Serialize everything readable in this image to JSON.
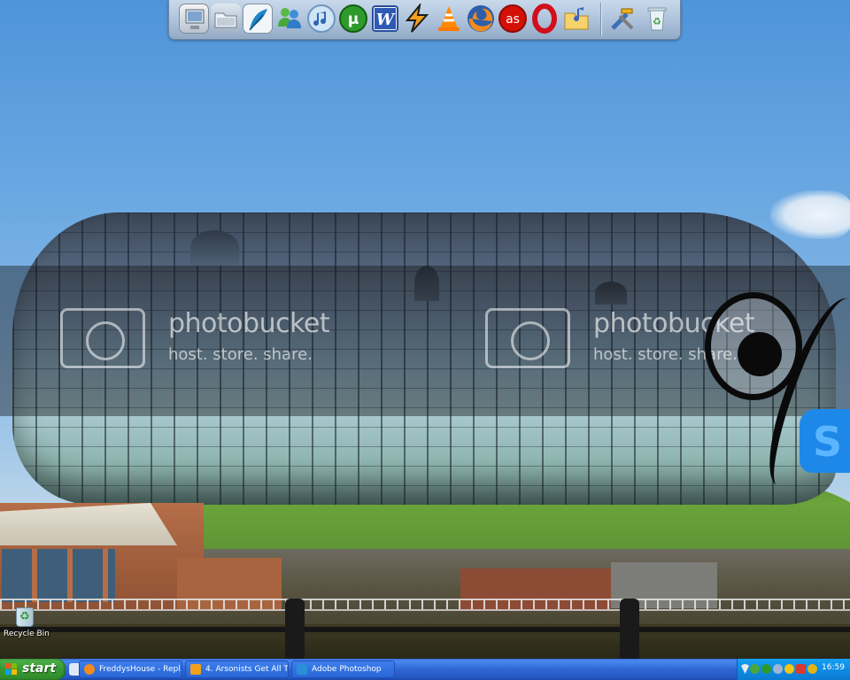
{
  "dock": {
    "items": [
      {
        "name": "my-computer-icon"
      },
      {
        "name": "folder-icon"
      },
      {
        "name": "feather-icon"
      },
      {
        "name": "messenger-icon"
      },
      {
        "name": "itunes-icon"
      },
      {
        "name": "utorrent-icon"
      },
      {
        "name": "word-icon"
      },
      {
        "name": "winamp-icon"
      },
      {
        "name": "vlc-icon"
      },
      {
        "name": "firefox-icon"
      },
      {
        "name": "lastfm-icon"
      },
      {
        "name": "opera-icon"
      },
      {
        "name": "music-folder-icon"
      },
      {
        "name": "tools-icon"
      },
      {
        "name": "recycle-bin-icon"
      }
    ],
    "word_letter": "W",
    "lastfm_letter": "as",
    "utorrent_letter": "µ",
    "opera_letter": "O"
  },
  "watermarks": [
    {
      "brand": "photobucket",
      "tagline": "host. store. share."
    },
    {
      "brand": "photobucket",
      "tagline": "host. store. share."
    }
  ],
  "desktop": {
    "recycle_bin_label": "Recycle Bin"
  },
  "taskbar": {
    "start_label": "start",
    "tasks": [
      {
        "label": "FreddysHouse - Repl...",
        "icon": "firefox-icon"
      },
      {
        "label": "4. Arsonists Get All T...",
        "icon": "winamp-icon"
      },
      {
        "label": "Adobe Photoshop",
        "icon": "photoshop-icon"
      }
    ],
    "clock": "16:59"
  },
  "colors": {
    "taskbar_blue": "#2f66d3",
    "start_green": "#3a9b35",
    "tray_blue": "#0d8ce4",
    "doodle_blue": "#1e88e8"
  }
}
